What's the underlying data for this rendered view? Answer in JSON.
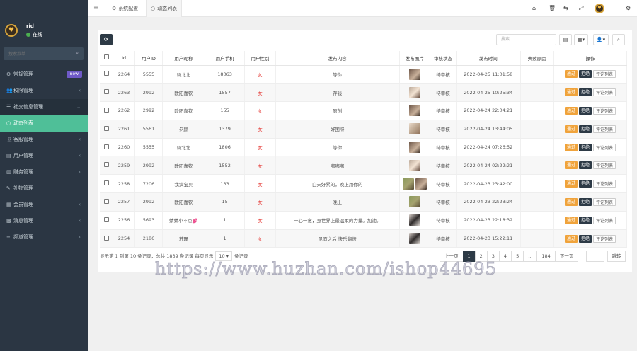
{
  "sidebar": {
    "user_name": "rid",
    "user_status": "在线",
    "search_placeholder": "搜索菜单",
    "items": [
      {
        "label": "常规管理",
        "badge": "new"
      },
      {
        "label": "权限管理",
        "arrow": "‹"
      },
      {
        "label": "社交信息管理",
        "arrow": "⌄"
      },
      {
        "label": "动态列表"
      },
      {
        "label": "客服管理",
        "arrow": "‹"
      },
      {
        "label": "用户管理",
        "arrow": "‹"
      },
      {
        "label": "财务管理",
        "arrow": "‹"
      },
      {
        "label": "礼物管理"
      },
      {
        "label": "会员管理",
        "arrow": "‹"
      },
      {
        "label": "消息管理",
        "arrow": "‹"
      },
      {
        "label": "频道管理",
        "arrow": "‹"
      }
    ]
  },
  "topbar": {
    "tabs": [
      {
        "label": "系统配置"
      },
      {
        "label": "动态列表"
      }
    ]
  },
  "toolbar": {
    "search_placeholder": "搜索"
  },
  "table": {
    "headers": [
      "",
      "Id",
      "用户ID",
      "用户昵称",
      "用户手机",
      "用户性别",
      "发布内容",
      "发布图片",
      "审核状态",
      "发布时间",
      "失败原因",
      "操作"
    ],
    "rows": [
      {
        "id": "2264",
        "uid": "5555",
        "nick": "骑北北",
        "phone": "18063",
        "gender": "女",
        "content": "等你",
        "status": "待审核",
        "time": "2022-04-25 11:01:58"
      },
      {
        "id": "2263",
        "uid": "2992",
        "nick": "欧阳嘉钦",
        "phone": "1557",
        "gender": "女",
        "content": "存钱",
        "status": "待审核",
        "time": "2022-04-25 10:25:34"
      },
      {
        "id": "2262",
        "uid": "2992",
        "nick": "欧阳嘉钦",
        "phone": "155",
        "gender": "女",
        "content": "原创",
        "status": "待审核",
        "time": "2022-04-24 22:04:21"
      },
      {
        "id": "2261",
        "uid": "5561",
        "nick": "夕颜",
        "phone": "1379",
        "gender": "女",
        "content": "好困呀",
        "status": "待审核",
        "time": "2022-04-24 13:44:05"
      },
      {
        "id": "2260",
        "uid": "5555",
        "nick": "骑北北",
        "phone": "1806",
        "gender": "女",
        "content": "等你",
        "status": "待审核",
        "time": "2022-04-24 07:26:52"
      },
      {
        "id": "2259",
        "uid": "2992",
        "nick": "欧阳嘉钦",
        "phone": "1552",
        "gender": "女",
        "content": "嘟嘟嘟",
        "status": "待审核",
        "time": "2022-04-24 02:22:21"
      },
      {
        "id": "2258",
        "uid": "7206",
        "nick": "我搞宝贝",
        "phone": "133",
        "gender": "女",
        "content": "白天好累的，晚上用你的",
        "status": "待审核",
        "time": "2022-04-23 23:42:00"
      },
      {
        "id": "2257",
        "uid": "2992",
        "nick": "欧阳嘉钦",
        "phone": "15",
        "gender": "女",
        "content": "晚上",
        "status": "待审核",
        "time": "2022-04-23 22:23:24"
      },
      {
        "id": "2256",
        "uid": "5693",
        "nick": "蜻蜻小不点💕",
        "phone": "1",
        "gender": "女",
        "content": "一心一意，身世界上最温柔的力量。加油。",
        "status": "待审核",
        "time": "2022-04-23 22:18:32"
      },
      {
        "id": "2254",
        "uid": "2186",
        "nick": "苏珊",
        "phone": "1",
        "gender": "女",
        "content": "见面之后 快乐翻倍",
        "status": "待审核",
        "time": "2022-04-23 15:22:11"
      }
    ],
    "op_pass": "通过",
    "op_reject": "拒绝",
    "op_comments": "评论列表"
  },
  "footer": {
    "info_prefix": "显示第 1 到第 10 条记录，总共 1839 条记录 每页显示",
    "page_size": "10",
    "info_suffix": "条记录",
    "prev": "上一页",
    "pages": [
      "1",
      "2",
      "3",
      "4",
      "5",
      "...",
      "184"
    ],
    "next": "下一页",
    "jump": "跳转"
  },
  "watermark": "https://www.huzhan.com/ishop44695",
  "colors": {
    "sidebar_bg": "#2b3643",
    "active_green": "#4fbf98",
    "pass_orange": "#f0a33b",
    "reject_dark": "#2d3a46",
    "gender_red": "#e53935"
  }
}
